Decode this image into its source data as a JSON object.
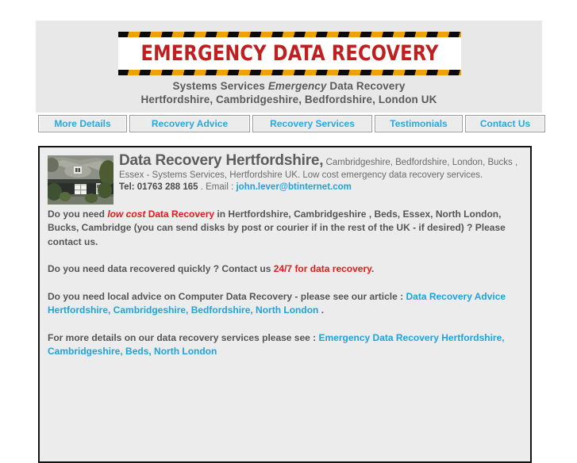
{
  "site": {
    "banner_title": "EMERGENCY DATA RECOVERY",
    "subtitle_line1_a": "Systems Services ",
    "subtitle_line1_em": "Emergency",
    "subtitle_line1_b": " Data Recovery",
    "subtitle_line2": "Hertfordshire, Cambridgeshire, Bedfordshire, London UK",
    "banner_text_color": "#c01f1f",
    "hazard_color": "#f0a000",
    "link_color": "#1fa2dd",
    "accent_red": "#e01b1b"
  },
  "nav": {
    "items": [
      {
        "label": "More Details"
      },
      {
        "label": "Recovery Advice"
      },
      {
        "label": "Recovery Services"
      },
      {
        "label": "Testimonials"
      },
      {
        "label": "Contact Us"
      }
    ]
  },
  "content": {
    "photo_alt": "thatched-cottage-photo",
    "headline": "Data Recovery Hertfordshire,",
    "headline_tail": " Cambridgeshire, Bedfordshire, London, Bucks , Essex - Systems Services, Hertfordshire UK.  Low cost emergency data recovery services.",
    "tel_label": "Tel: 01763 288 165",
    "email_sep": " . Email : ",
    "email": "john.lever@btinternet.com",
    "para1_a": "Do you need ",
    "para1_red_i": "low cost",
    "para1_red": " Data Recovery",
    "para1_b": " in Hertfordshire, Cambridgeshire , Beds, Essex, North London, Bucks, Cambridge (you can send disks by post or courier if in the rest of the UK - if desired) ?  Please contact us.",
    "para2_a": "Do you need data recovered quickly ? Contact us ",
    "para2_red": "24/7 for data recovery",
    "para2_b": ".",
    "para3_a": "Do you need local advice on Computer Data Recovery - please see our article : ",
    "para3_link": "Data Recovery Advice Hertfordshire, Cambridgeshire, Bedfordshire, North London",
    "para3_b": " .",
    "para4_a": "For more details on our data recovery services  please see : ",
    "para4_link": "Emergency Data Recovery Hertfordshire, Cambridgeshire, Beds, North London"
  }
}
